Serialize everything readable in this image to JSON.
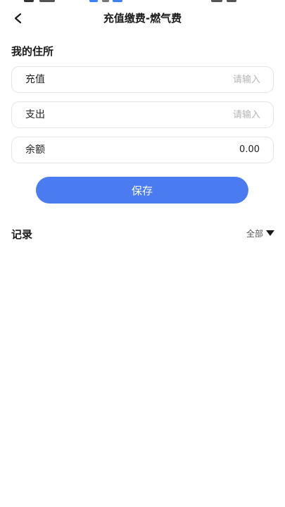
{
  "header": {
    "title": "充值缴费-燃气费",
    "back_icon": "chevron-left-icon"
  },
  "residence": {
    "section_title": "我的住所",
    "recharge": {
      "label": "充值",
      "placeholder": "请输入",
      "value": ""
    },
    "expense": {
      "label": "支出",
      "placeholder": "请输入",
      "value": ""
    },
    "balance": {
      "label": "余额",
      "value": "0.00"
    }
  },
  "actions": {
    "save_label": "保存"
  },
  "records": {
    "section_title": "记录",
    "filter": {
      "selected": "全部",
      "icon": "caret-down-icon"
    }
  },
  "colors": {
    "primary": "#4A7BF0",
    "text": "#1a1a1a",
    "placeholder": "#b4b4b4",
    "border": "#e4e4e4"
  }
}
